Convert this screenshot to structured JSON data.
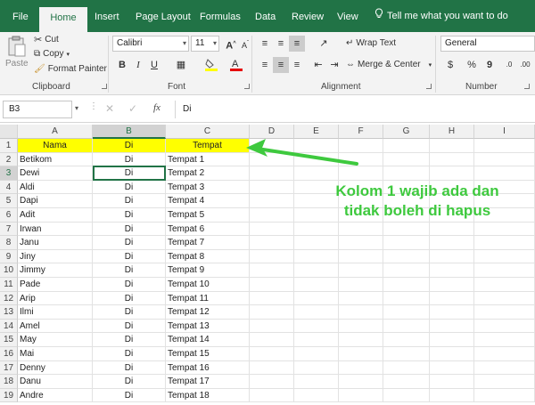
{
  "menu": {
    "tabs": [
      "File",
      "Home",
      "Insert",
      "Page Layout",
      "Formulas",
      "Data",
      "Review",
      "View"
    ],
    "tell_me": "Tell me what you want to do"
  },
  "ribbon": {
    "clipboard": {
      "paste": "Paste",
      "cut": "Cut",
      "copy": "Copy",
      "format_painter": "Format Painter",
      "label": "Clipboard"
    },
    "font": {
      "name": "Calibri",
      "size": "11",
      "bold": "B",
      "italic": "I",
      "underline": "U",
      "grow": "A",
      "shrink": "A",
      "label": "Font"
    },
    "alignment": {
      "wrap_text": "Wrap Text",
      "merge_center": "Merge & Center",
      "label": "Alignment"
    },
    "number": {
      "format": "General",
      "percent": "%",
      "comma": "9",
      "label": "Number"
    }
  },
  "formula_bar": {
    "name_box": "B3",
    "fx": "fx",
    "value": "Di"
  },
  "columns": [
    "A",
    "B",
    "C",
    "D",
    "E",
    "F",
    "G",
    "H",
    "I"
  ],
  "rows": [
    [
      "1",
      "Nama",
      "Di",
      "Tempat"
    ],
    [
      "2",
      "Betikom",
      "Di",
      "Tempat 1"
    ],
    [
      "3",
      "Dewi",
      "Di",
      "Tempat 2"
    ],
    [
      "4",
      "Aldi",
      "Di",
      "Tempat 3"
    ],
    [
      "5",
      "Dapi",
      "Di",
      "Tempat 4"
    ],
    [
      "6",
      "Adit",
      "Di",
      "Tempat 5"
    ],
    [
      "7",
      "Irwan",
      "Di",
      "Tempat 6"
    ],
    [
      "8",
      "Janu",
      "Di",
      "Tempat 7"
    ],
    [
      "9",
      "Jiny",
      "Di",
      "Tempat 8"
    ],
    [
      "10",
      "Jimmy",
      "Di",
      "Tempat 9"
    ],
    [
      "11",
      "Pade",
      "Di",
      "Tempat 10"
    ],
    [
      "12",
      "Arip",
      "Di",
      "Tempat 11"
    ],
    [
      "13",
      "Ilmi",
      "Di",
      "Tempat 12"
    ],
    [
      "14",
      "Amel",
      "Di",
      "Tempat 13"
    ],
    [
      "15",
      "May",
      "Di",
      "Tempat 14"
    ],
    [
      "16",
      "Mai",
      "Di",
      "Tempat 15"
    ],
    [
      "17",
      "Denny",
      "Di",
      "Tempat 16"
    ],
    [
      "18",
      "Danu",
      "Di",
      "Tempat 17"
    ],
    [
      "19",
      "Andre",
      "Di",
      "Tempat 18"
    ]
  ],
  "annotation": {
    "line1": "Kolom 1 wajib ada dan",
    "line2": "tidak boleh di hapus"
  },
  "colors": {
    "excel_green": "#217346",
    "header_fill": "#ffff00",
    "annotation": "#3ec93e"
  }
}
